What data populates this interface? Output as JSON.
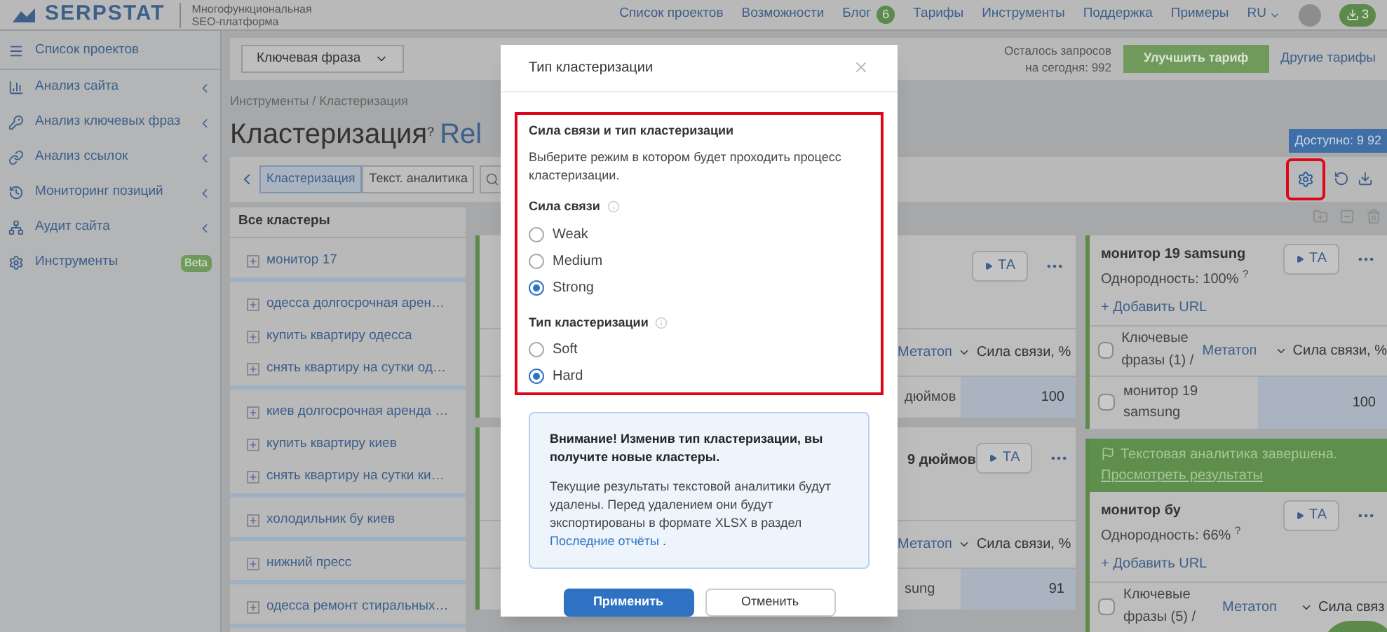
{
  "header": {
    "logo": "SERPSTAT",
    "tagline": "Многофункциональная SEO-платформа",
    "nav": [
      {
        "label": "Список проектов"
      },
      {
        "label": "Возможности"
      },
      {
        "label": "Блог",
        "badge": "6"
      },
      {
        "label": "Тарифы"
      },
      {
        "label": "Инструменты"
      },
      {
        "label": "Поддержка"
      },
      {
        "label": "Примеры"
      }
    ],
    "language": "RU",
    "downloads": "3"
  },
  "sidebar": {
    "items": [
      {
        "label": "Список проектов",
        "submenu": false
      },
      {
        "label": "Анализ сайта",
        "submenu": true
      },
      {
        "label": "Анализ ключевых фраз",
        "submenu": true
      },
      {
        "label": "Анализ ссылок",
        "submenu": true
      },
      {
        "label": "Мониторинг позиций",
        "submenu": true
      },
      {
        "label": "Аудит сайта",
        "submenu": true
      },
      {
        "label": "Инструменты",
        "submenu": false,
        "badge": "Beta"
      }
    ]
  },
  "toolbar": {
    "search_type": "Ключевая фраза",
    "remaining": "Осталось запросов на сегодня: 992",
    "upgrade": "Улучшить тариф",
    "other_plans": "Другие тарифы"
  },
  "breadcrumb": "Инструменты / Кластеризация",
  "title": "Кластеризация",
  "title_hint": "?",
  "project": "Rel",
  "available": "Доступно: 9 92",
  "tabs": [
    {
      "label": "Кластеризация",
      "selected": true
    },
    {
      "label": "Текст. аналитика",
      "selected": false
    }
  ],
  "cluster_list": {
    "heading": "Все кластеры",
    "groups": [
      [
        "монитор 17"
      ],
      [
        "одесса долгосрочная арен…",
        "купить квартиру одесса",
        "снять квартиру на сутки од…"
      ],
      [
        "киев долгосрочная аренда …",
        "купить квартиру киев",
        "снять квартиру на сутки ки…"
      ],
      [
        "холодильник бу киев"
      ],
      [
        "нижний пресс"
      ],
      [
        "одесса ремонт стиральных…"
      ]
    ]
  },
  "middle_cards": [
    {
      "button": "ТА",
      "metatop": "Метатоп",
      "strength": "Сила связи, %",
      "rows": [
        {
          "keyword": "дюймов",
          "value": "100"
        }
      ]
    },
    {
      "title": "9 дюймов",
      "button": "ТА",
      "metatop": "Метатоп",
      "strength": "Сила связи, %",
      "rows": [
        {
          "keyword": "sung",
          "value": "91"
        }
      ]
    }
  ],
  "right_cards": [
    {
      "title": "монитор 19 samsung",
      "homogeneity": "Однородность: 100%",
      "hint": "?",
      "button": "ТА",
      "add_url": "+ Добавить URL",
      "keywords": "Ключевые фразы (1) /",
      "metatop": "Метатоп",
      "strength": "Сила связи, %",
      "all_checked": false,
      "rows": [
        {
          "keyword": "монитор 19 samsung",
          "value": "100",
          "checked": false
        }
      ]
    },
    {
      "banner": "Текстовая аналитика завершена.",
      "banner_link": "Просмотреть результаты",
      "title": "монитор бу",
      "homogeneity": "Однородность: 66%",
      "hint": "?",
      "button": "ТА",
      "add_url": "+ Добавить URL",
      "keywords": "Ключевые фразы (5) /",
      "metatop": "Метатоп",
      "strength": "Сила связ",
      "all_checked": false
    }
  ],
  "modal": {
    "title": "Тип кластеризации",
    "section_title": "Сила связи и тип кластеризации",
    "description": "Выберите режим в котором будет проходить процесс кластеризации.",
    "groups": [
      {
        "label": "Сила связи",
        "options": [
          {
            "label": "Weak",
            "selected": false
          },
          {
            "label": "Medium",
            "selected": false
          },
          {
            "label": "Strong",
            "selected": true
          }
        ]
      },
      {
        "label": "Тип кластеризации",
        "options": [
          {
            "label": "Soft",
            "selected": false
          },
          {
            "label": "Hard",
            "selected": true
          }
        ]
      }
    ],
    "warning_title": "Внимание! Изменив тип кластеризации, вы получите новые кластеры.",
    "warning_text": "Текущие результаты текстовой аналитики будут удалены. Перед удалением они будут экспортированы в формате XLSX в раздел",
    "warning_link": "Последние отчёты",
    "warning_end": ".",
    "apply": "Применить",
    "cancel": "Отменить"
  }
}
